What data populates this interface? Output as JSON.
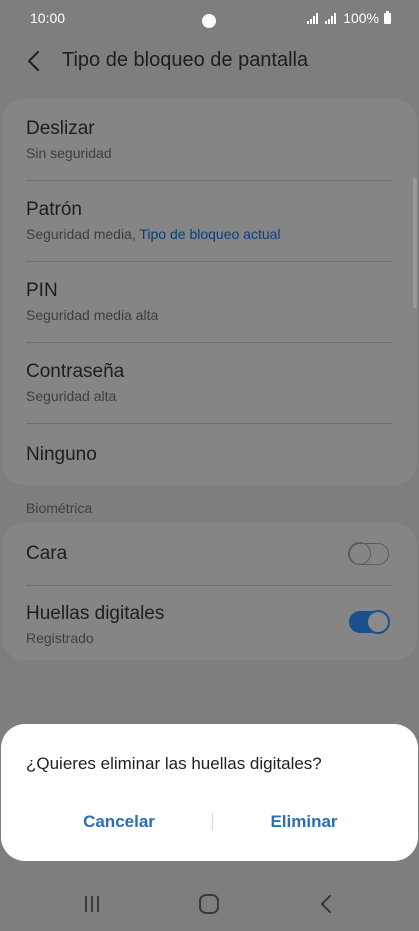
{
  "status": {
    "time": "10:00",
    "battery": "100%"
  },
  "header": {
    "title": "Tipo de bloqueo de pantalla"
  },
  "lock_types": [
    {
      "title": "Deslizar",
      "subtitle": "Sin seguridad"
    },
    {
      "title": "Patrón",
      "subtitle": "Seguridad media, ",
      "subtitle_accent": "Tipo de bloqueo actual"
    },
    {
      "title": "PIN",
      "subtitle": "Seguridad media alta"
    },
    {
      "title": "Contraseña",
      "subtitle": "Seguridad alta"
    },
    {
      "title": "Ninguno"
    }
  ],
  "biometrics": {
    "header": "Biométrica",
    "items": [
      {
        "title": "Cara",
        "enabled": false
      },
      {
        "title": "Huellas digitales",
        "subtitle": "Registrado",
        "enabled": true
      }
    ]
  },
  "dialog": {
    "message": "¿Quieres eliminar las huellas digitales?",
    "cancel_label": "Cancelar",
    "confirm_label": "Eliminar"
  },
  "colors": {
    "accent": "#2a6eb4",
    "toggle_on": "#1b4f8c",
    "scrim": "#7e7e7e"
  },
  "icons": {
    "back": "chevron-left-icon",
    "recents": "recents-icon",
    "home": "home-icon",
    "nav_back": "nav-back-icon"
  }
}
